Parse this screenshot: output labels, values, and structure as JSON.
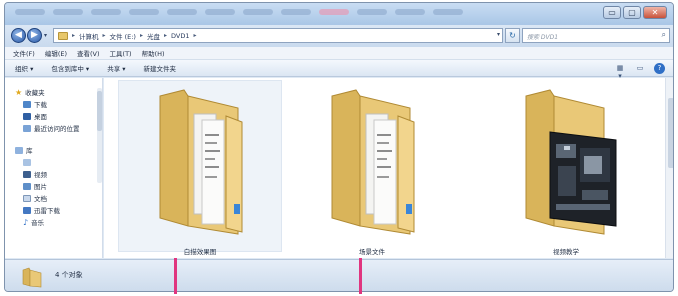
{
  "titlebar": {
    "buttons": [
      "▭",
      "▢",
      "✕"
    ]
  },
  "address": {
    "back": "◀",
    "forward": "▶",
    "crumbs": [
      "计算机",
      "文件 (E:)",
      "光盘",
      "DVD1"
    ],
    "refresh": "↻",
    "search_placeholder": "搜索 DVD1",
    "search_icon": "⌕"
  },
  "menu": [
    "文件(F)",
    "编辑(E)",
    "查看(V)",
    "工具(T)",
    "帮助(H)"
  ],
  "toolbar": [
    "组织 ▾",
    "包含到库中 ▾",
    "共享 ▾",
    "新建文件夹"
  ],
  "nav": {
    "favorites_title": "收藏夹",
    "favorites": [
      "下载",
      "桌面",
      "最近访问的位置"
    ],
    "library_title": "库",
    "library": [
      "视频",
      "图片",
      "文档",
      "迅雷下载",
      "音乐"
    ]
  },
  "folders": [
    {
      "label": "白描效果图",
      "kind": "docs"
    },
    {
      "label": "场景文件",
      "kind": "docs"
    },
    {
      "label": "视频教学",
      "kind": "video"
    }
  ],
  "status": {
    "count": "4 个对象"
  },
  "colors": {
    "accent_marker": "#e0357f",
    "folder": "#e8c76a"
  }
}
